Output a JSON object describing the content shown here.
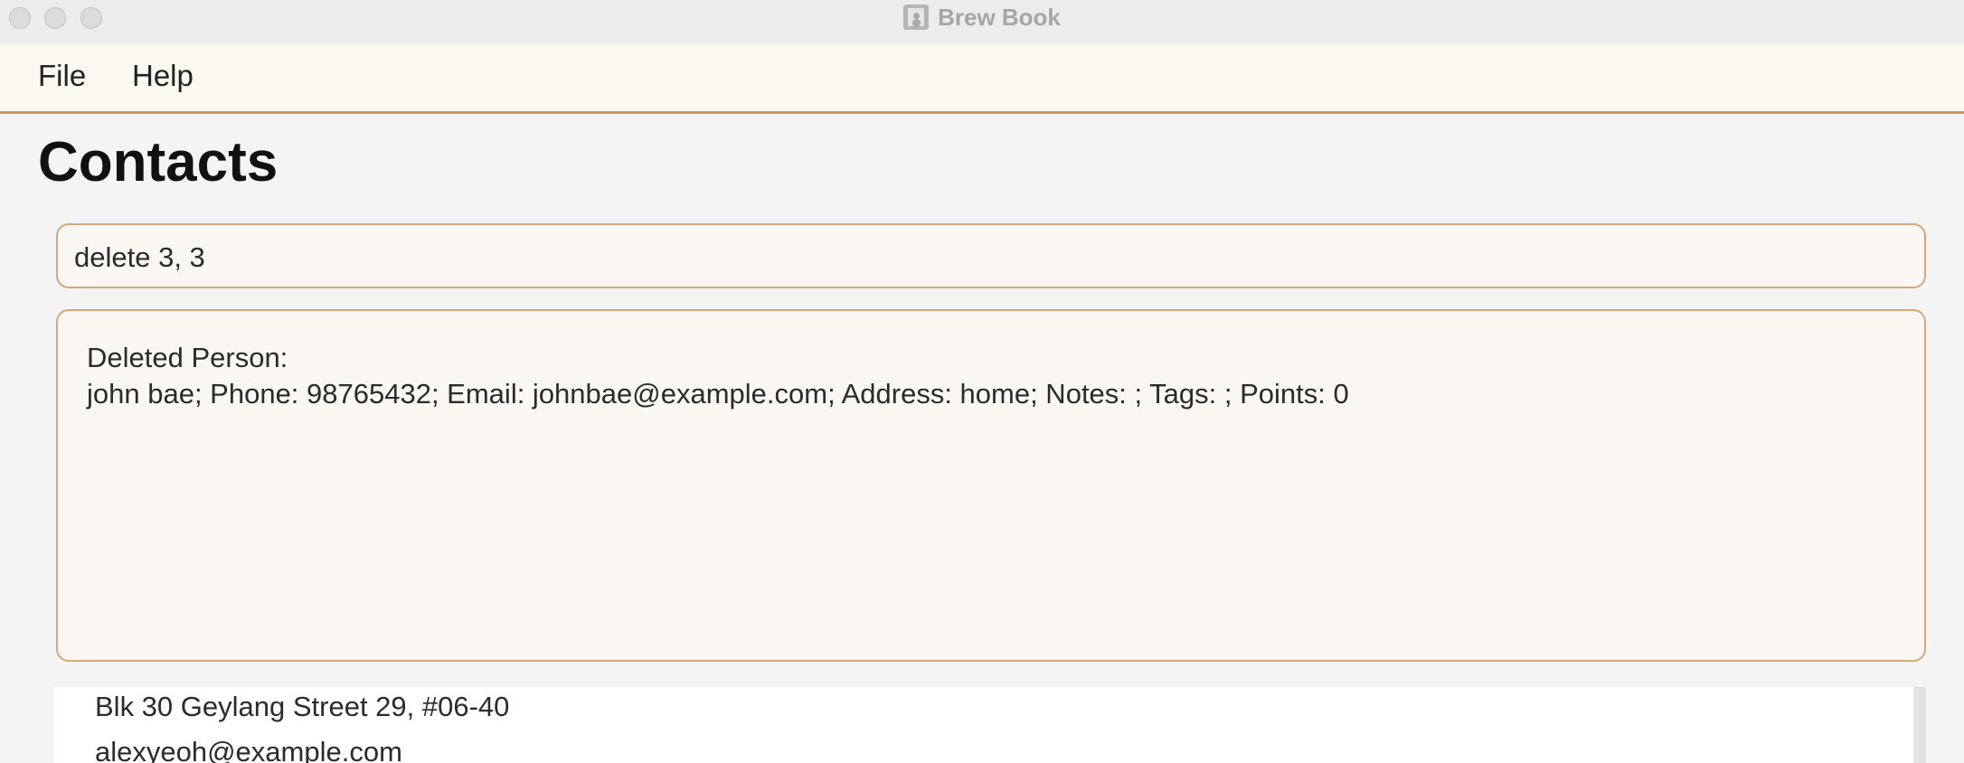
{
  "window": {
    "title": "Brew Book",
    "icon": "address-book-icon"
  },
  "menu": {
    "file": "File",
    "help": "Help"
  },
  "page": {
    "title": "Contacts"
  },
  "command": {
    "value": "delete 3, 3"
  },
  "result": {
    "line1": "Deleted Person:",
    "line2": "john bae; Phone: 98765432; Email: johnbae@example.com; Address: home; Notes: ; Tags: ; Points: 0"
  },
  "contact_card": {
    "address": "Blk 30 Geylang Street 29, #06-40",
    "email": "alexyeoh@example.com"
  },
  "colors": {
    "accent": "#c9995c",
    "panel_bg": "#faf7f2",
    "menubar_bg": "#fbf7f1",
    "page_bg": "#f4f4f4"
  }
}
